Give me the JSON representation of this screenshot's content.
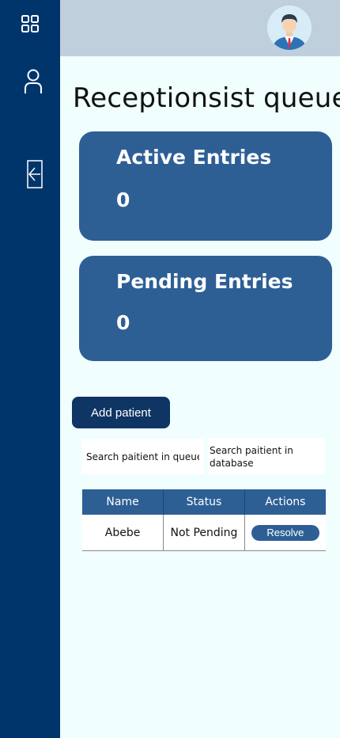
{
  "sidebar": {
    "icons": [
      "dashboard-icon",
      "user-icon",
      "logout-icon"
    ]
  },
  "header": {
    "avatar_icon": "user-avatar"
  },
  "page": {
    "title": "Receptionsist queue"
  },
  "cards": {
    "active": {
      "label": "Active Entries",
      "value": "0"
    },
    "pending": {
      "label": "Pending Entries",
      "value": "0"
    }
  },
  "actions": {
    "add_patient_label": "Add patient"
  },
  "search": {
    "queue_placeholder": "Search paitient in queue",
    "database_placeholder": "Search paitient in\ndatabase"
  },
  "table": {
    "headers": {
      "name": "Name",
      "status": "Status",
      "actions": "Actions"
    },
    "rows": [
      {
        "name": "Abebe",
        "status": "Not Pending",
        "action_label": "Resolve"
      }
    ]
  },
  "colors": {
    "sidebar": "#00356b",
    "topbar": "#c0cfdc",
    "background": "#f0fefe",
    "card": "#2d5f95",
    "button_dark": "#0e3563"
  }
}
